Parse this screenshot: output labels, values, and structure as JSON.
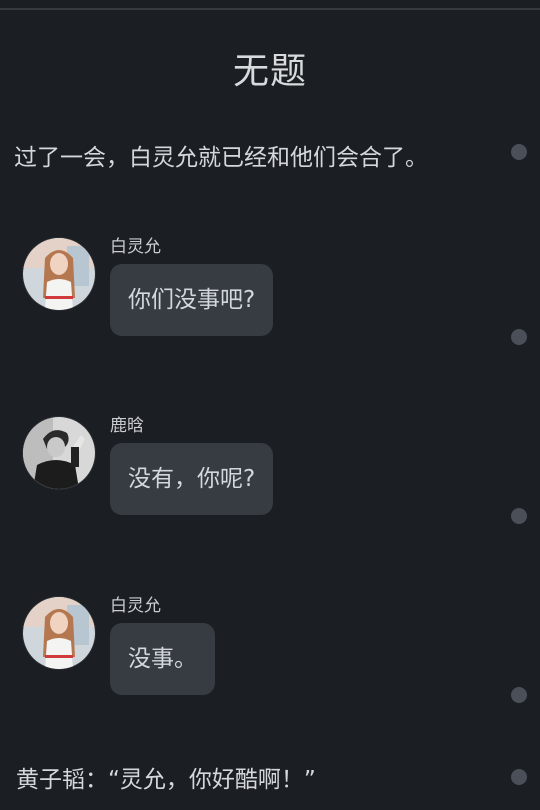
{
  "story": {
    "title": "无题",
    "narration_1": "过了一会，白灵允就已经和他们会合了。",
    "narration_2": "黄子韬：“灵允，你好酷啊！”"
  },
  "messages": [
    {
      "sender": "白灵允",
      "text": "你们没事吧?",
      "avatar_icon": "female-avatar-icon"
    },
    {
      "sender": "鹿晗",
      "text": "没有，你呢?",
      "avatar_icon": "male-avatar-icon"
    },
    {
      "sender": "白灵允",
      "text": "没事。",
      "avatar_icon": "female-avatar-icon"
    }
  ],
  "colors": {
    "background": "#1b1e22",
    "bubble": "#363c42",
    "text": "#d4d8dc",
    "dot": "#4b5058"
  }
}
